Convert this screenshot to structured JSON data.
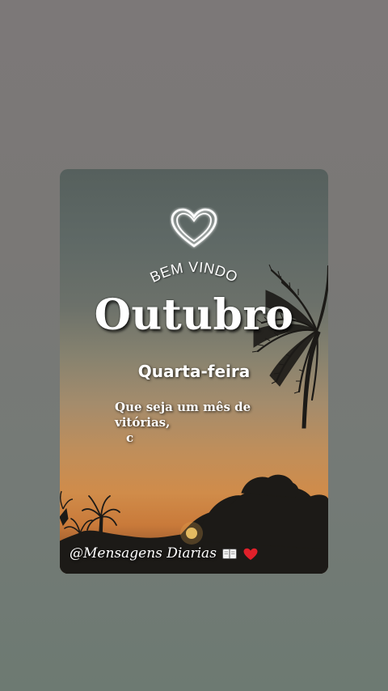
{
  "card": {
    "welcome_text": "BEM VINDO",
    "month": "Outubro",
    "weekday": "Quarta-feira",
    "message_line1": "Que seja um mês de vitórias,",
    "message_line2": "c"
  },
  "watermark": {
    "handle": "@Mensagens Diarias",
    "icons": [
      "book-icon",
      "red-heart-icon"
    ]
  },
  "colors": {
    "sky_top": "#56605d",
    "sky_horizon": "#d08c4a",
    "silhouette": "#1a1512",
    "text": "#ffffff",
    "heart_red": "#e0202a"
  }
}
